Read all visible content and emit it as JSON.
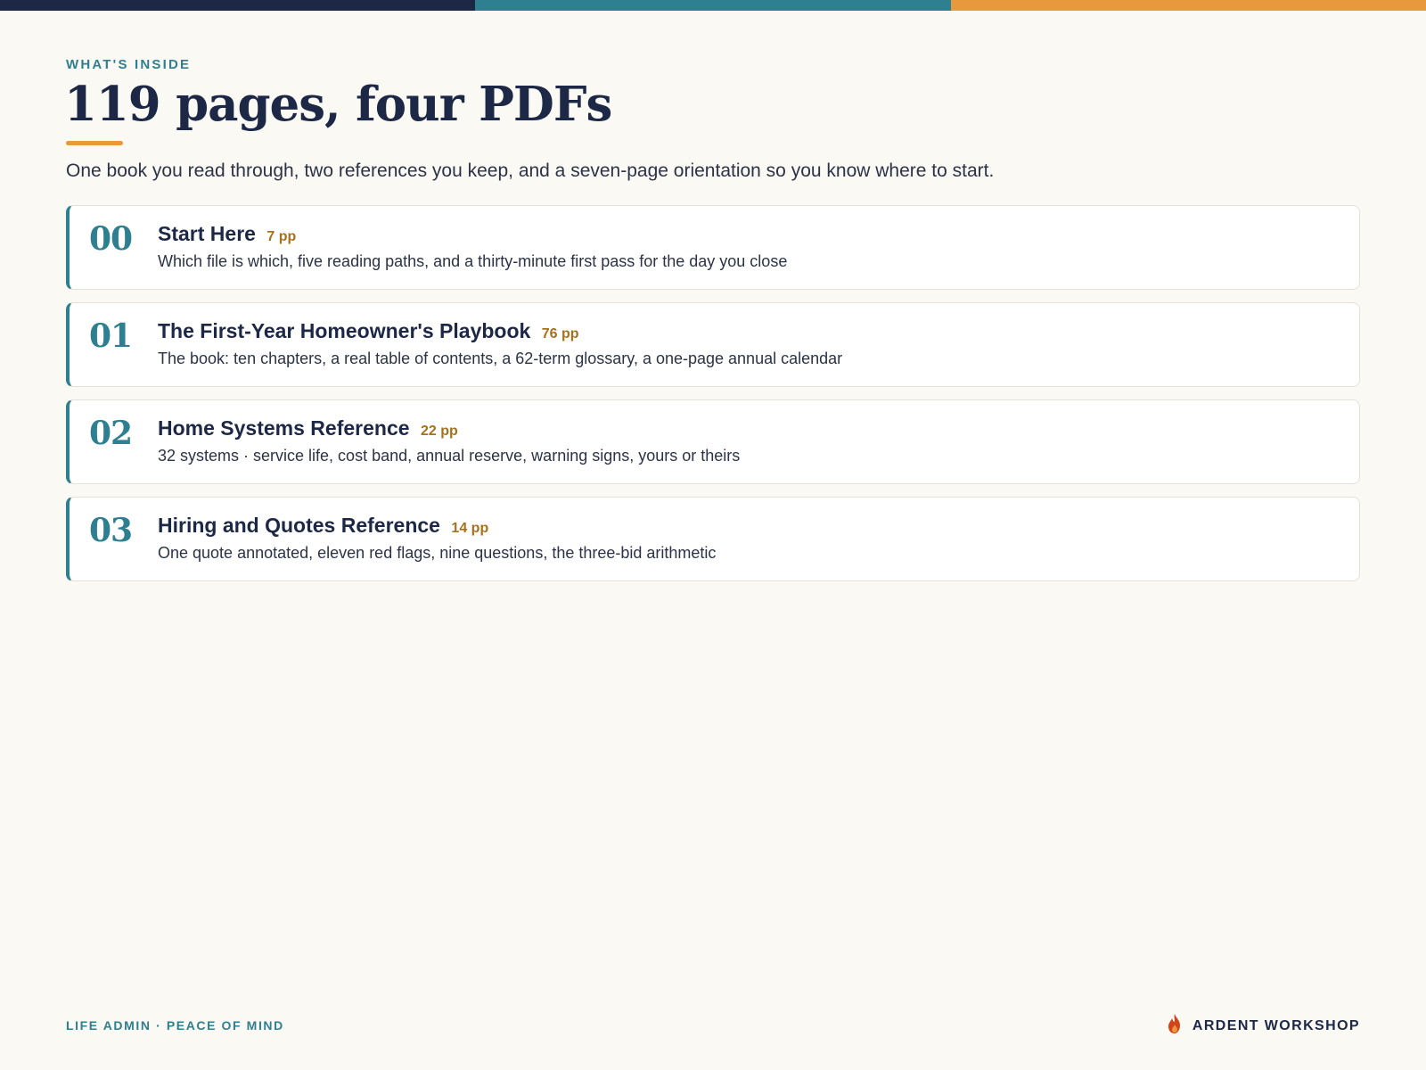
{
  "colors": {
    "navy": "#1c2845",
    "teal": "#2e7f8f",
    "orange": "#e8993c",
    "amber": "#a6711a",
    "flame": "#d0451b"
  },
  "header": {
    "eyebrow": "WHAT'S INSIDE",
    "title": "119 pages, four PDFs",
    "intro": "One book you read through, two references you keep, and a seven-page orientation so you know where to start."
  },
  "files": [
    {
      "number": "00",
      "title": "Start Here",
      "pages": "7 pp",
      "description": "Which file is which, five reading paths, and a thirty-minute first pass for the day you close"
    },
    {
      "number": "01",
      "title": "The First-Year Homeowner's Playbook",
      "pages": "76 pp",
      "description": "The book: ten chapters, a real table of contents, a 62-term glossary, a one-page annual calendar"
    },
    {
      "number": "02",
      "title": "Home Systems Reference",
      "pages": "22 pp",
      "description": "32 systems · service life, cost band, annual reserve, warning signs, yours or theirs"
    },
    {
      "number": "03",
      "title": "Hiring and Quotes Reference",
      "pages": "14 pp",
      "description": "One quote annotated, eleven red flags, nine questions, the three-bid arithmetic"
    }
  ],
  "footer": {
    "tagline": "LIFE ADMIN · PEACE OF MIND",
    "brand_icon": "flame-icon",
    "brand": "ARDENT WORKSHOP"
  }
}
